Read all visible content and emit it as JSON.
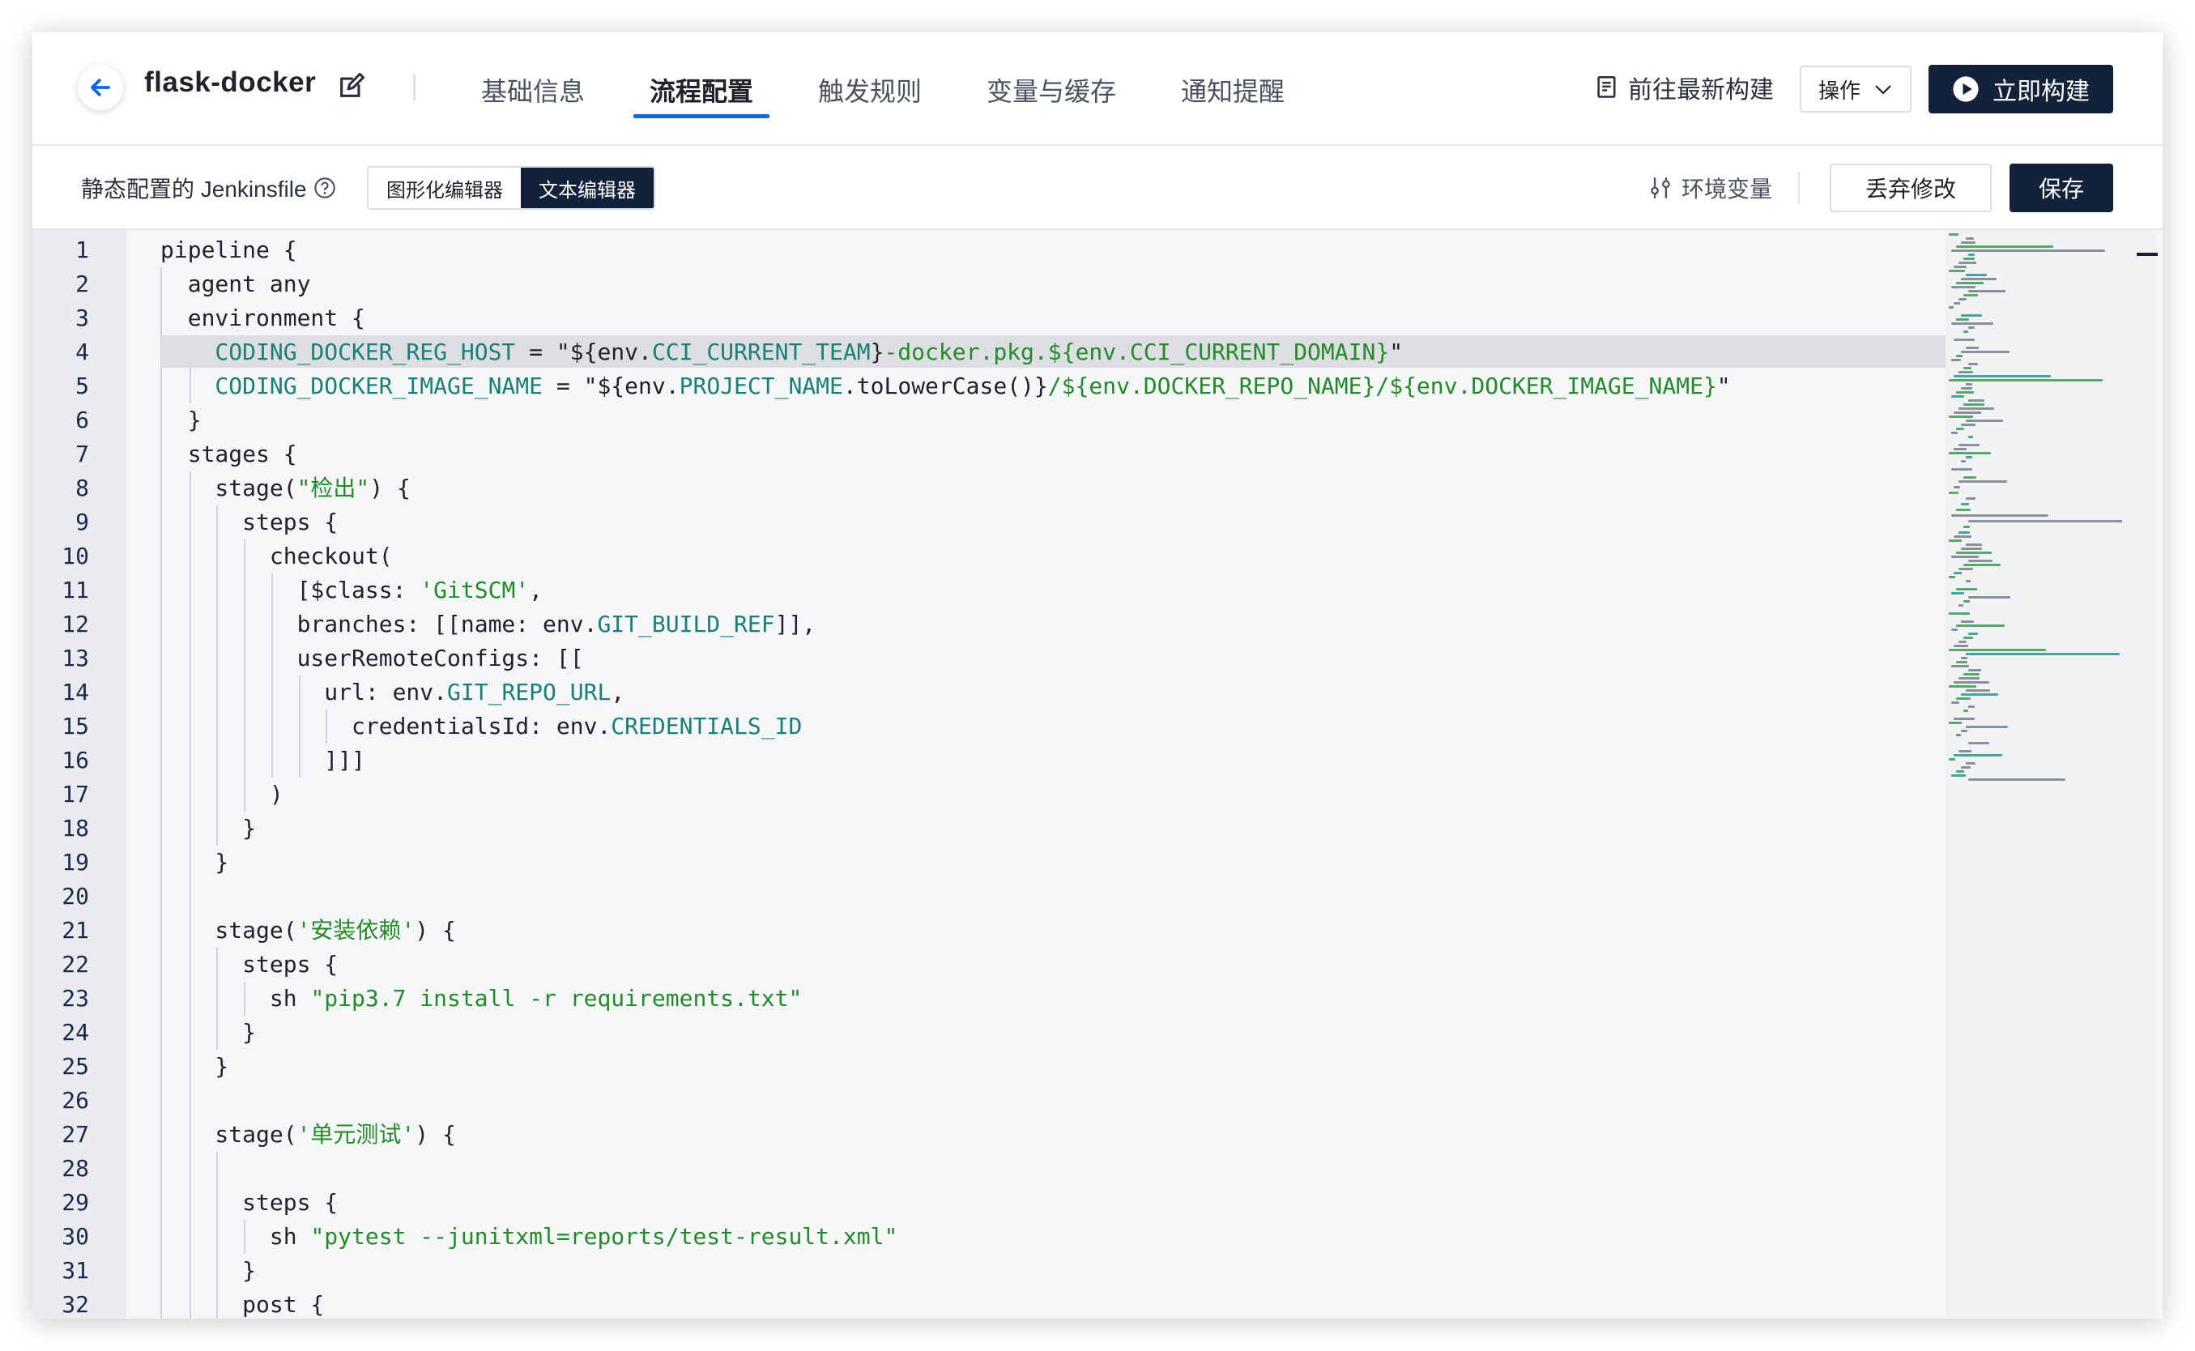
{
  "header": {
    "project_title": "flask-docker",
    "tabs": [
      "基础信息",
      "流程配置",
      "触发规则",
      "变量与缓存",
      "通知提醒"
    ],
    "active_tab": "流程配置",
    "latest_build_label": "前往最新构建",
    "ops_label": "操作",
    "build_now_label": "立即构建"
  },
  "toolbar": {
    "static_label": "静态配置的 Jenkinsfile",
    "editor_modes": [
      "图形化编辑器",
      "文本编辑器"
    ],
    "active_mode": "文本编辑器",
    "env_vars_label": "环境变量",
    "discard_label": "丢弃修改",
    "save_label": "保存"
  },
  "editor": {
    "highlighted_line": 4,
    "lines": [
      [
        [
          "",
          "pipeline {"
        ]
      ],
      [
        [
          "",
          "  agent any"
        ]
      ],
      [
        [
          "",
          "  environment {"
        ]
      ],
      [
        [
          "var",
          "    CODING_DOCKER_REG_HOST"
        ],
        [
          "",
          " = "
        ],
        [
          "",
          "\"${env."
        ],
        [
          "var",
          "CCI_CURRENT_TEAM"
        ],
        [
          "",
          "}"
        ],
        [
          "str",
          "-docker.pkg.${env.CCI_CURRENT_DOMAIN}"
        ],
        [
          "",
          "\""
        ]
      ],
      [
        [
          "var",
          "    CODING_DOCKER_IMAGE_NAME"
        ],
        [
          "",
          " = "
        ],
        [
          "",
          "\"${env."
        ],
        [
          "var",
          "PROJECT_NAME"
        ],
        [
          "",
          ".toLowerCase()}"
        ],
        [
          "str",
          "/${env.DOCKER_REPO_NAME}/${env.DOCKER_IMAGE_NAME}"
        ],
        [
          "",
          "\""
        ]
      ],
      [
        [
          "",
          "  }"
        ]
      ],
      [
        [
          "",
          "  stages {"
        ]
      ],
      [
        [
          "",
          "    stage("
        ],
        [
          "str",
          "\"检出\""
        ],
        [
          "",
          ") {"
        ]
      ],
      [
        [
          "",
          "      steps {"
        ]
      ],
      [
        [
          "",
          "        checkout("
        ]
      ],
      [
        [
          "",
          "          [$class: "
        ],
        [
          "str",
          "'GitSCM'"
        ],
        [
          "",
          ","
        ]
      ],
      [
        [
          "",
          "          branches: [[name: env."
        ],
        [
          "var",
          "GIT_BUILD_REF"
        ],
        [
          "",
          "]],"
        ]
      ],
      [
        [
          "",
          "          userRemoteConfigs: [["
        ]
      ],
      [
        [
          "",
          "            url: env."
        ],
        [
          "var",
          "GIT_REPO_URL"
        ],
        [
          "",
          ","
        ]
      ],
      [
        [
          "",
          "              credentialsId: env."
        ],
        [
          "var",
          "CREDENTIALS_ID"
        ]
      ],
      [
        [
          "",
          "            ]]]"
        ]
      ],
      [
        [
          "",
          "        )"
        ]
      ],
      [
        [
          "",
          "      }"
        ]
      ],
      [
        [
          "",
          "    }"
        ]
      ],
      [
        [
          "",
          ""
        ]
      ],
      [
        [
          "",
          "    stage("
        ],
        [
          "str",
          "'安装依赖'"
        ],
        [
          "",
          ") {"
        ]
      ],
      [
        [
          "",
          "      steps {"
        ]
      ],
      [
        [
          "",
          "        sh "
        ],
        [
          "str",
          "\"pip3.7 install -r requirements.txt\""
        ]
      ],
      [
        [
          "",
          "      }"
        ]
      ],
      [
        [
          "",
          "    }"
        ]
      ],
      [
        [
          "",
          ""
        ]
      ],
      [
        [
          "",
          "    stage("
        ],
        [
          "str",
          "'单元测试'"
        ],
        [
          "",
          ") {"
        ]
      ],
      [
        [
          "",
          ""
        ]
      ],
      [
        [
          "",
          "      steps {"
        ]
      ],
      [
        [
          "",
          "        sh "
        ],
        [
          "str",
          "\"pytest --junitxml=reports/test-result.xml\""
        ]
      ],
      [
        [
          "",
          "      }"
        ]
      ],
      [
        [
          "",
          "      post {"
        ]
      ]
    ]
  },
  "colors": {
    "accent": "#1166e0",
    "dark_button": "#14213a",
    "code_variable": "#1a7f76",
    "code_string": "#248a2a"
  }
}
